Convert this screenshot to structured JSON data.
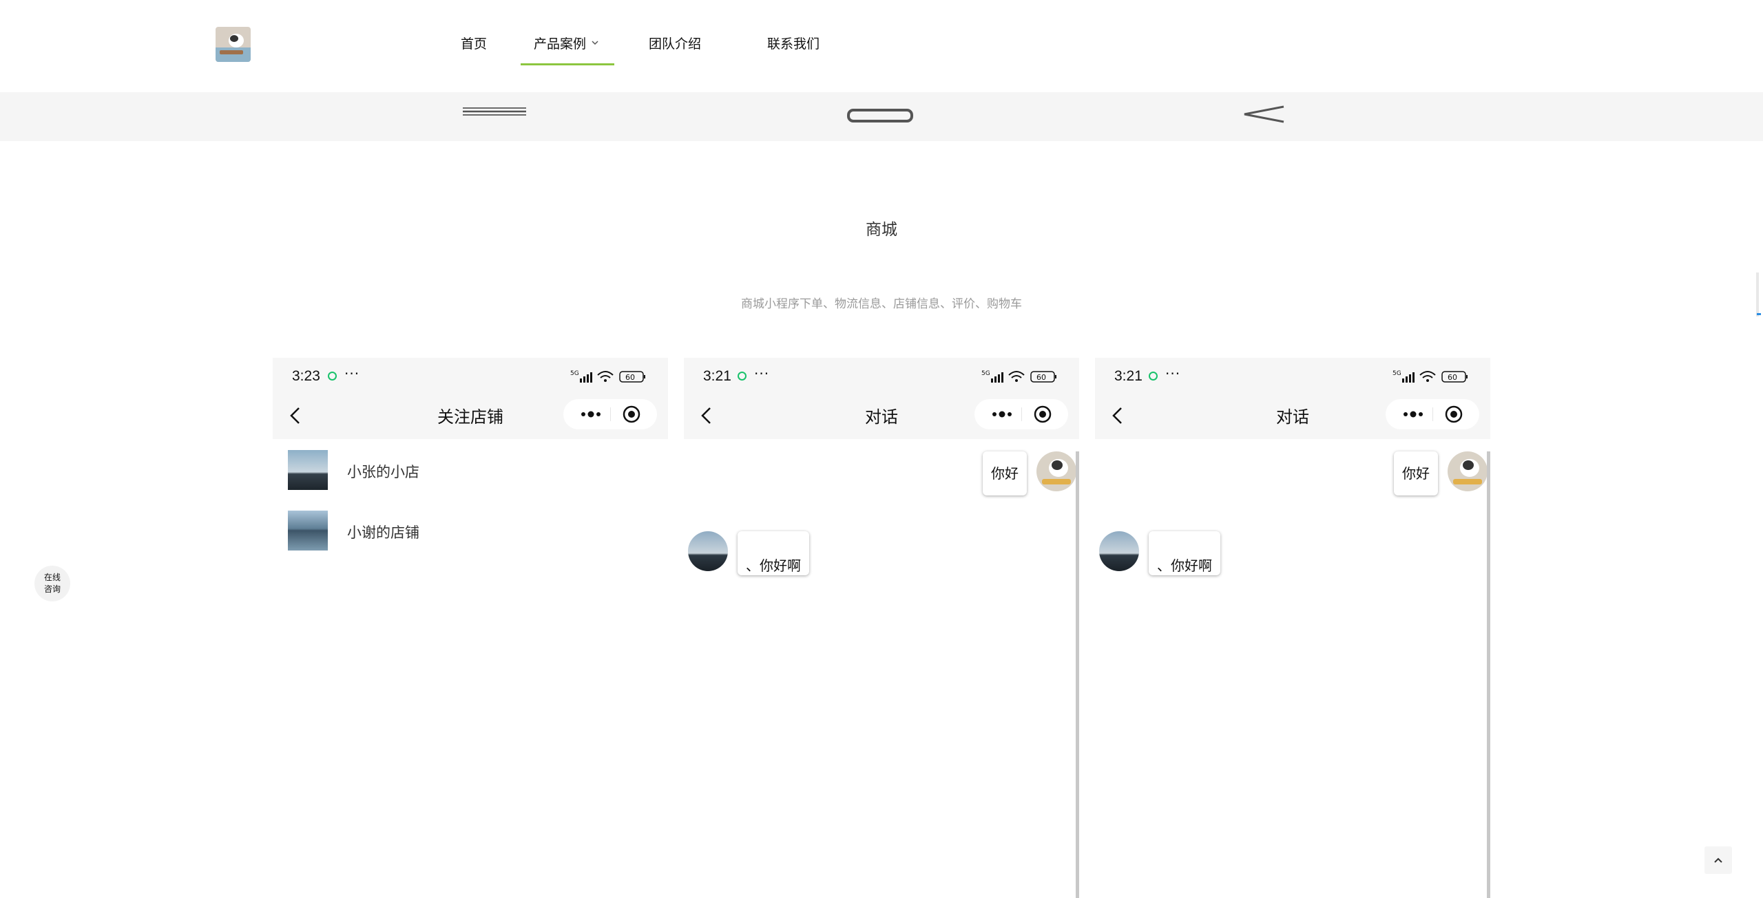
{
  "header": {
    "nav": [
      {
        "label": "首页"
      },
      {
        "label": "产品案例",
        "active": true
      },
      {
        "label": "团队介绍"
      },
      {
        "label": "联系我们"
      }
    ],
    "accent_color": "#8cc63f"
  },
  "band_icons": [
    "menu-lines-icon",
    "rounded-rect-home-icon",
    "back-angle-icon"
  ],
  "section": {
    "title": "商城",
    "subtitle": "商城小程序下单、物流信息、店铺信息、评价、购物车"
  },
  "phones": [
    {
      "time": "3:23",
      "more": "···",
      "signal": "5G",
      "battery": "60",
      "title": "关注店铺",
      "shops": [
        {
          "name": "小张的小店"
        },
        {
          "name": "小谢的店铺"
        }
      ]
    },
    {
      "time": "3:21",
      "more": "···",
      "signal": "5G",
      "battery": "60",
      "title": "对话",
      "messages": [
        {
          "from": "me",
          "text": "你好"
        },
        {
          "from": "other",
          "text": "、你好啊"
        }
      ]
    },
    {
      "time": "3:21",
      "more": "···",
      "signal": "5G",
      "battery": "60",
      "title": "对话",
      "messages": [
        {
          "from": "me",
          "text": "你好"
        },
        {
          "from": "other",
          "text": "、你好啊"
        }
      ]
    }
  ],
  "floating": {
    "consult_line1": "在线",
    "consult_line2": "咨询"
  }
}
